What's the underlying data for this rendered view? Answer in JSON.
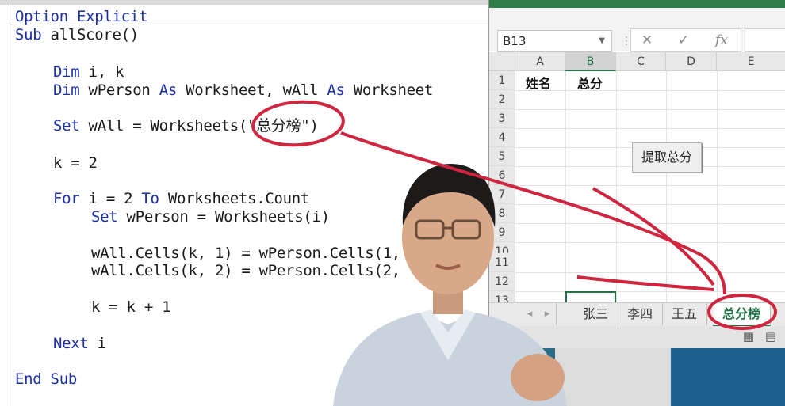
{
  "editor": {
    "code_lines": [
      {
        "kw": "Option Explicit",
        "text": ""
      },
      {
        "kw": "Sub",
        "text": " allScore()"
      },
      {
        "kw": "Dim",
        "text": " i, k"
      },
      {
        "kw": "Dim",
        "text": " wPerson ",
        "kw2": "As",
        "text2": " Worksheet, wAll ",
        "kw3": "As",
        "text3": " Worksheet"
      },
      {
        "kw": "Set",
        "text": " wAll = Worksheets(\"总分榜\")"
      },
      {
        "kw": "",
        "text": "k = 2"
      },
      {
        "kw": "For",
        "text": " i = 2 ",
        "kw2": "To",
        "text2": " Worksheets.Count"
      },
      {
        "kw": "Set",
        "text": " wPerson = Worksheets(i)"
      },
      {
        "kw": "",
        "text": "wAll.Cells(k, 1) = wPerson.Cells(1,"
      },
      {
        "kw": "",
        "text": "wAll.Cells(k, 2) = wPerson.Cells(2,"
      },
      {
        "kw": "",
        "text": "k = k + 1"
      },
      {
        "kw": "Next",
        "text": " i"
      },
      {
        "kw": "End Sub",
        "text": ""
      }
    ]
  },
  "excel": {
    "name_box": "B13",
    "formula_icons": [
      "close-icon",
      "check-icon",
      "function-icon"
    ],
    "formula_glyphs": {
      "cancel": "✕",
      "confirm": "✓",
      "fx": "fx"
    },
    "columns": [
      "A",
      "B",
      "C",
      "D",
      "E"
    ],
    "selected_column": "B",
    "rows": [
      "1",
      "2",
      "3",
      "4",
      "5",
      "6",
      "7",
      "8",
      "9",
      "10",
      "11",
      "12",
      "13"
    ],
    "cells": {
      "A1": "姓名",
      "B1": "总分"
    },
    "macro_button": "提取总分",
    "sheet_tabs": [
      "张三",
      "李四",
      "王五",
      "总分榜"
    ],
    "active_sheet": "总分榜",
    "colors": {
      "excel_green": "#217346",
      "keyword_blue": "#1a2fa8",
      "annotation_red": "#d0253f"
    }
  }
}
